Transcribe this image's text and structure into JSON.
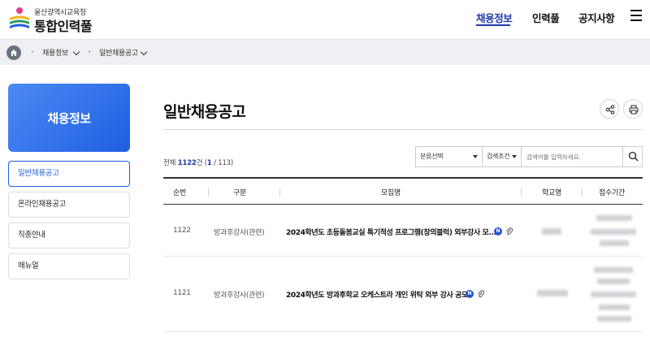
{
  "header": {
    "logo_sub": "울산광역시교육청",
    "logo_main": "통합인력풀",
    "nav": [
      "채용정보",
      "인력풀",
      "공지사항"
    ],
    "active_nav": "채용정보"
  },
  "breadcrumb": [
    "채용정보",
    "일반채용공고"
  ],
  "sidebar": {
    "hero": "채용정보",
    "items": [
      {
        "label": "일반채용공고",
        "active": true
      },
      {
        "label": "온라인채용공고",
        "active": false
      },
      {
        "label": "직종안내",
        "active": false
      },
      {
        "label": "매뉴얼",
        "active": false
      }
    ]
  },
  "main": {
    "title": "일반채용공고",
    "total_prefix": "전체",
    "total_count": "1122",
    "total_suffix": "건",
    "page_current": "1",
    "page_total": "113",
    "search": {
      "category_select": "분류선택",
      "condition_select": "검색조건",
      "placeholder": "검색어를 입력하세요."
    },
    "table": {
      "headers": [
        "순번",
        "구분",
        "모집명",
        "학교명",
        "접수기간"
      ],
      "rows": [
        {
          "no": "1122",
          "type": "방과후강사(관련)",
          "title": "2024학년도 초등돌봄교실 특기적성 프로그램(창의블럭) 외부강사 모...",
          "badge": "N"
        },
        {
          "no": "1121",
          "type": "방과후강사(관련)",
          "title": "2024학년도 방과후학교 오케스트라 개인 위탁 외부 강사 공모",
          "badge": "N"
        }
      ]
    }
  },
  "colors": {
    "accent": "#1e3aa8",
    "hero_gradient_start": "#4c89f5",
    "hero_gradient_end": "#1f5fe0"
  },
  "icons": [
    "home-icon",
    "menu-icon",
    "share-icon",
    "print-icon",
    "search-icon",
    "attachment-icon"
  ]
}
